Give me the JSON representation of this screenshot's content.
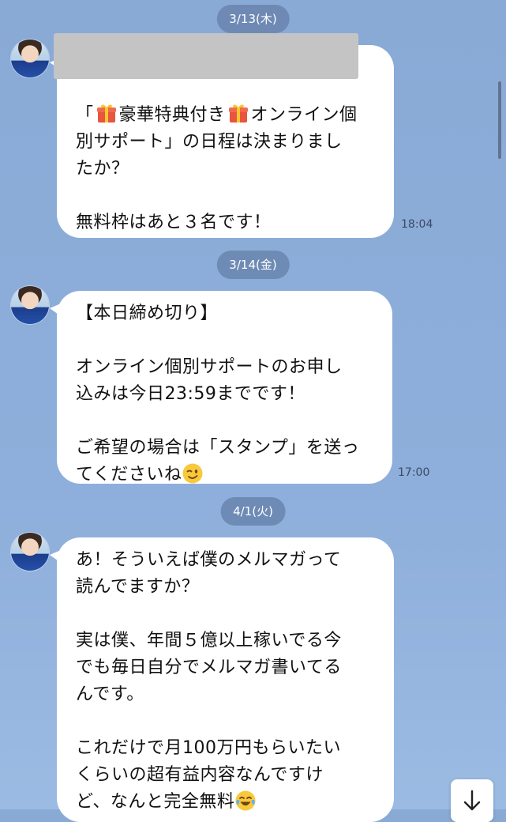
{
  "dates": [
    "3/13(木)",
    "3/14(金)",
    "4/1(火)"
  ],
  "messages": [
    {
      "lines": [
        "オンライン個",
        "別サポート」の日程は決まりまし",
        "たか？",
        "",
        "無料枠はあと３名です！"
      ],
      "first_prefix": "「",
      "first_mid": "豪華特典付き",
      "time": "18:04"
    },
    {
      "lines": [
        "【本日締め切り】",
        "",
        "オンライン個別サポートのお申し",
        "込みは今日23:59までです！",
        "",
        "ご希望の場合は「スタンプ」を送っ",
        "てくださいね"
      ],
      "time": "17:00"
    },
    {
      "lines": [
        "あ！そういえば僕のメルマガって",
        "読んでますか？",
        "",
        "実は僕、年間５億以上稼いでる今",
        "でも毎日自分でメルマガ書いてる",
        "んです。",
        "",
        "これだけで月100万円もらいたい",
        "くらいの超有益内容なんですけ",
        "ど、なんと完全無料"
      ]
    }
  ],
  "icons": {
    "gift": "gift-emoji-icon",
    "wink": "winking-face-icon",
    "laugh": "tears-of-joy-icon",
    "scroll": "arrow-down-icon"
  }
}
